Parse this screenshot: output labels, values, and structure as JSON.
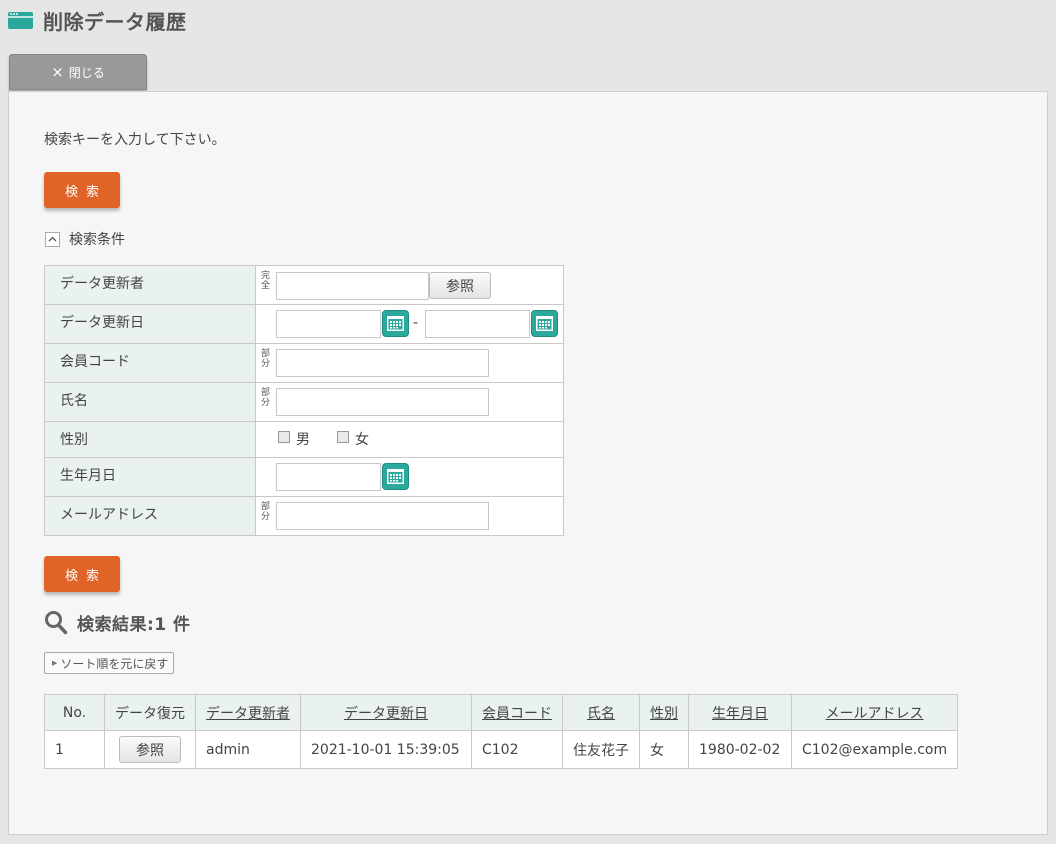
{
  "header": {
    "title": "削除データ履歴",
    "icon": "window-icon"
  },
  "toolbar": {
    "close_label": "閉じる",
    "close_icon": "×"
  },
  "search": {
    "instruction": "検索キーを入力して下さい。",
    "button_label": "検索",
    "conditions_label": "検索条件",
    "fields": {
      "updater": {
        "label": "データ更新者",
        "mode": "完全",
        "value": "",
        "ref_label": "参照"
      },
      "update_date": {
        "label": "データ更新日",
        "from": "",
        "to": "",
        "separator": "-"
      },
      "member_code": {
        "label": "会員コード",
        "mode": "部分",
        "value": ""
      },
      "name": {
        "label": "氏名",
        "mode": "部分",
        "value": ""
      },
      "gender": {
        "label": "性別",
        "male": "男",
        "female": "女",
        "male_checked": false,
        "female_checked": false
      },
      "birthday": {
        "label": "生年月日",
        "value": ""
      },
      "email": {
        "label": "メールアドレス",
        "mode": "部分",
        "value": ""
      }
    }
  },
  "results": {
    "title": "検索結果:1 件",
    "sort_reset_label": "ソート順を元に戻す",
    "columns": [
      "No.",
      "データ復元",
      "データ更新者",
      "データ更新日",
      "会員コード",
      "氏名",
      "性別",
      "生年月日",
      "メールアドレス"
    ],
    "rows": [
      {
        "no": "1",
        "restore_label": "参照",
        "updater": "admin",
        "updated": "2021-10-01 15:39:05",
        "member_code": "C102",
        "name": "住友花子",
        "gender": "女",
        "birthday": "1980-02-02",
        "email": "C102@example.com"
      }
    ]
  },
  "colors": {
    "accent": "#e06428",
    "teal": "#2aa99c",
    "label_bg": "#e9f2f1"
  }
}
